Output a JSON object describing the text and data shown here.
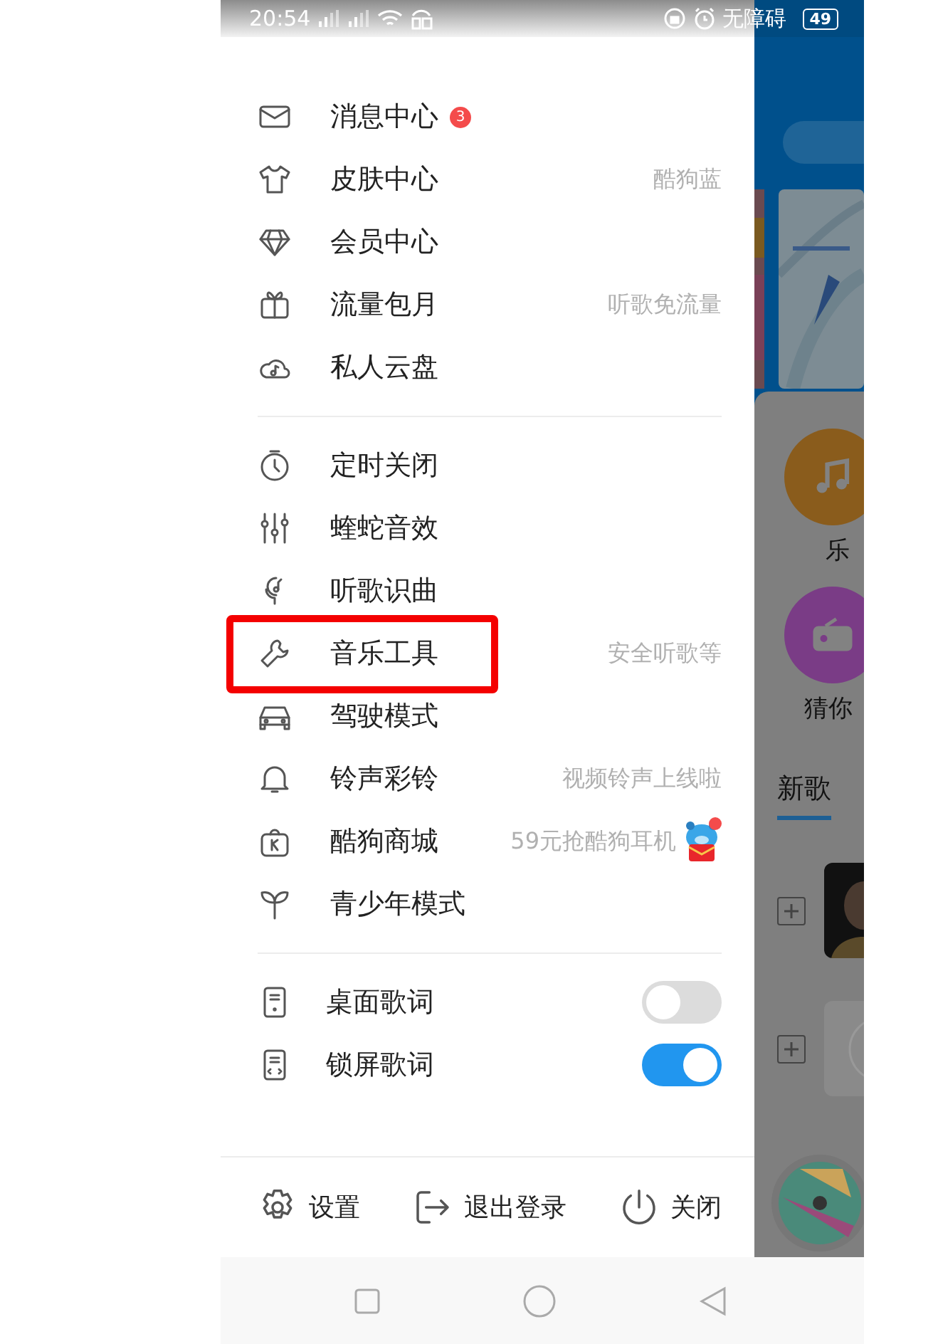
{
  "status_bar": {
    "time": "20:54",
    "accessibility_label": "无障碍",
    "battery": "49"
  },
  "menu_sections": [
    {
      "items": [
        {
          "label": "消息中心",
          "badge": "3",
          "new_dot": false,
          "highlighted": false
        },
        {
          "label": "皮肤中心",
          "hint": "酷狗蓝",
          "new_dot": false,
          "highlighted": false
        },
        {
          "label": "会员中心",
          "new_dot": false,
          "highlighted": false
        },
        {
          "label": "流量包月",
          "hint": "听歌免流量",
          "new_dot": false,
          "highlighted": false
        },
        {
          "label": "私人云盘",
          "new_dot": false,
          "highlighted": false
        }
      ]
    },
    {
      "items": [
        {
          "label": "定时关闭",
          "new_dot": false,
          "highlighted": false
        },
        {
          "label": "蝰蛇音效",
          "new_dot": false,
          "highlighted": false
        },
        {
          "label": "听歌识曲",
          "new_dot": false,
          "highlighted": false
        },
        {
          "label": "音乐工具",
          "hint": "安全听歌等",
          "new_dot": false,
          "highlighted": true
        },
        {
          "label": "驾驶模式",
          "new_dot": false,
          "highlighted": false
        },
        {
          "label": "铃声彩铃",
          "hint": "视频铃声上线啦",
          "new_dot": false,
          "highlighted": false
        },
        {
          "label": "酷狗商城",
          "hint": "59元抢酷狗耳机",
          "new_dot": true,
          "highlighted": false
        },
        {
          "label": "青少年模式",
          "new_dot": false,
          "highlighted": false
        }
      ]
    }
  ],
  "lyrics_toggles": [
    {
      "label": "桌面歌词",
      "on": false
    },
    {
      "label": "锁屏歌词",
      "on": true
    }
  ],
  "footer_actions": [
    {
      "label": "设置"
    },
    {
      "label": "退出登录"
    },
    {
      "label": "关闭"
    }
  ],
  "background_app": {
    "shortcuts": [
      {
        "label": "乐",
        "color": "#8a5c1c"
      },
      {
        "label": "猜你",
        "color": "#7a3c86"
      }
    ],
    "section_title": "新歌"
  }
}
